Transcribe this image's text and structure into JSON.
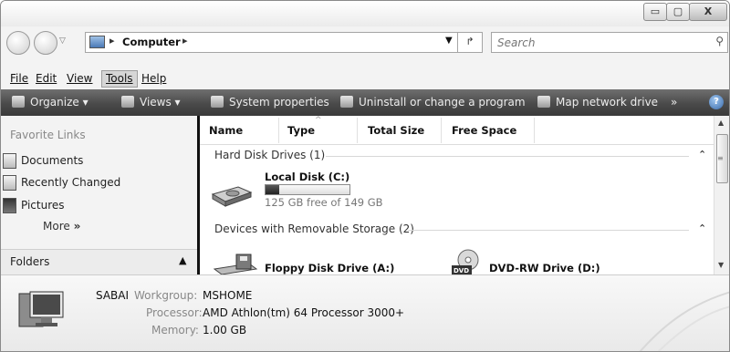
{
  "window": {
    "controls": {
      "minimize": "▭",
      "maximize": "▢",
      "close": "X"
    }
  },
  "address": {
    "crumbs": [
      "Computer"
    ],
    "dropdown_icon": "chevron-down-icon"
  },
  "search": {
    "placeholder": "Search"
  },
  "menubar": {
    "items": [
      {
        "label": "File"
      },
      {
        "label": "Edit"
      },
      {
        "label": "View"
      },
      {
        "label": "Tools",
        "active": true
      },
      {
        "label": "Help"
      }
    ]
  },
  "commandbar": {
    "organize": "Organize",
    "views": "Views",
    "system_properties": "System properties",
    "uninstall": "Uninstall or change a program",
    "map_drive": "Map network drive",
    "overflow": "»",
    "help": "?"
  },
  "left_pane": {
    "favorites_title": "Favorite Links",
    "favorites": [
      {
        "label": "Documents",
        "icon": "documents-icon"
      },
      {
        "label": "Recently Changed",
        "icon": "recent-icon"
      },
      {
        "label": "Pictures",
        "icon": "pictures-icon"
      }
    ],
    "more": "More",
    "folders": "Folders"
  },
  "columns": [
    "Name",
    "Type",
    "Total Size",
    "Free Space"
  ],
  "groups": {
    "hard_disks": "Hard Disk Drives (1)",
    "removable": "Devices with Removable Storage (2)"
  },
  "drives": {
    "local": {
      "name": "Local Disk (C:)",
      "free_text": "125 GB free of 149 GB",
      "used_fraction": 0.16
    },
    "floppy": {
      "name": "Floppy Disk Drive (A:)"
    },
    "dvd": {
      "name": "DVD-RW Drive (D:)",
      "badge": "DVD"
    }
  },
  "details": {
    "computer_name": "SABAI",
    "workgroup_label": "Workgroup:",
    "workgroup_value": "MSHOME",
    "processor_label": "Processor:",
    "processor_value": "AMD Athlon(tm) 64 Processor 3000+",
    "memory_label": "Memory:",
    "memory_value": "1.00 GB"
  }
}
